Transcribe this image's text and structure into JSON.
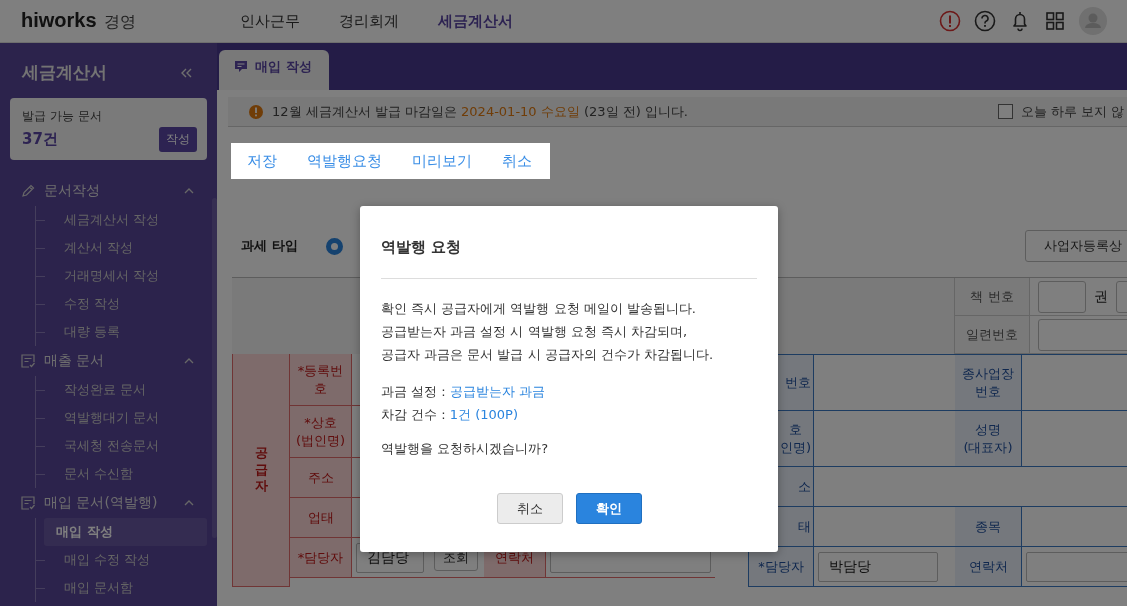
{
  "header": {
    "logo": "hiworks",
    "product": "경영",
    "nav": [
      {
        "label": "인사근무",
        "selected": false
      },
      {
        "label": "경리회계",
        "selected": false
      },
      {
        "label": "세금계산서",
        "selected": true
      }
    ],
    "alert": true
  },
  "sidebar": {
    "title": "세금계산서",
    "card": {
      "label": "발급 가능 문서",
      "count": "37건",
      "button": "작성"
    },
    "groups": [
      {
        "label": "문서작성",
        "expanded": true,
        "children": [
          {
            "label": "세금계산서 작성",
            "selected": false
          },
          {
            "label": "계산서 작성",
            "selected": false
          },
          {
            "label": "거래명세서 작성",
            "selected": false
          },
          {
            "label": "수정 작성",
            "selected": false
          },
          {
            "label": "대량 등록",
            "selected": false
          }
        ]
      },
      {
        "label": "매출 문서",
        "expanded": true,
        "children": [
          {
            "label": "작성완료 문서",
            "selected": false
          },
          {
            "label": "역발행대기 문서",
            "selected": false
          },
          {
            "label": "국세청 전송문서",
            "selected": false
          },
          {
            "label": "문서 수신함",
            "selected": false
          }
        ]
      },
      {
        "label": "매입 문서(역발행)",
        "expanded": true,
        "children": [
          {
            "label": "매입 작성",
            "selected": true
          },
          {
            "label": "매입 수정 작성",
            "selected": false
          },
          {
            "label": "매입 문서함",
            "selected": false
          }
        ]
      }
    ]
  },
  "tabs": [
    {
      "label": "매입 작성",
      "selected": true
    }
  ],
  "notice": {
    "segments": [
      {
        "text": "12월 세금계산서 발급 마감일은 ",
        "highlight": false
      },
      {
        "text": "2024-01-10 수요일",
        "highlight": true
      },
      {
        "text": " (23일 전) 입니다.",
        "highlight": false
      }
    ],
    "dismiss": {
      "label": "오늘 하루 보지 않",
      "checked": false
    }
  },
  "toolbar": [
    "저장",
    "역발행요청",
    "미리보기",
    "취소"
  ],
  "tax_type": {
    "label": "과세 타입",
    "selected": true
  },
  "status_button": "사업자등록상",
  "book": {
    "label": "책 번호",
    "unit": "권",
    "serial_label": "일련번호"
  },
  "supplier": {
    "title": "공급자",
    "rows": [
      {
        "label": "*등록번호"
      },
      {
        "label": "*상호",
        "sub": "(법인명)"
      },
      {
        "label": "주소"
      },
      {
        "label": "업태"
      },
      {
        "label": "*담당자",
        "value": "김담당",
        "button": "조회",
        "label2": "연락처",
        "field2": true
      }
    ]
  },
  "receiver": {
    "rows": [
      {
        "label": "번호",
        "label2": "종사업장",
        "sub2": "번호"
      },
      {
        "label": "호",
        "sub": "인명)",
        "label2": "성명",
        "sub2": "(대표자)"
      },
      {
        "label": "소"
      },
      {
        "label": "태",
        "label2": "종목"
      },
      {
        "label": "*담당자",
        "value": "박담당",
        "label2": "연락처",
        "field2": true
      }
    ]
  },
  "modal": {
    "title": "역발행 요청",
    "message": [
      "확인 즉시 공급자에게 역발행 요청 메일이 발송됩니다.",
      "공급받는자 과금 설정 시 역발행 요청 즉시 차감되며,",
      "공급자 과금은 문서 발급 시 공급자의 건수가 차감됩니다."
    ],
    "details": [
      {
        "label": "과금 설정 : ",
        "value": "공급받는자 과금"
      },
      {
        "label": "차감 건수 : ",
        "value": "1건 (100P)"
      }
    ],
    "question": "역발행을 요청하시겠습니까?",
    "buttons": [
      {
        "label": "취소",
        "kind": "secondary"
      },
      {
        "label": "확인",
        "kind": "primary"
      }
    ]
  }
}
